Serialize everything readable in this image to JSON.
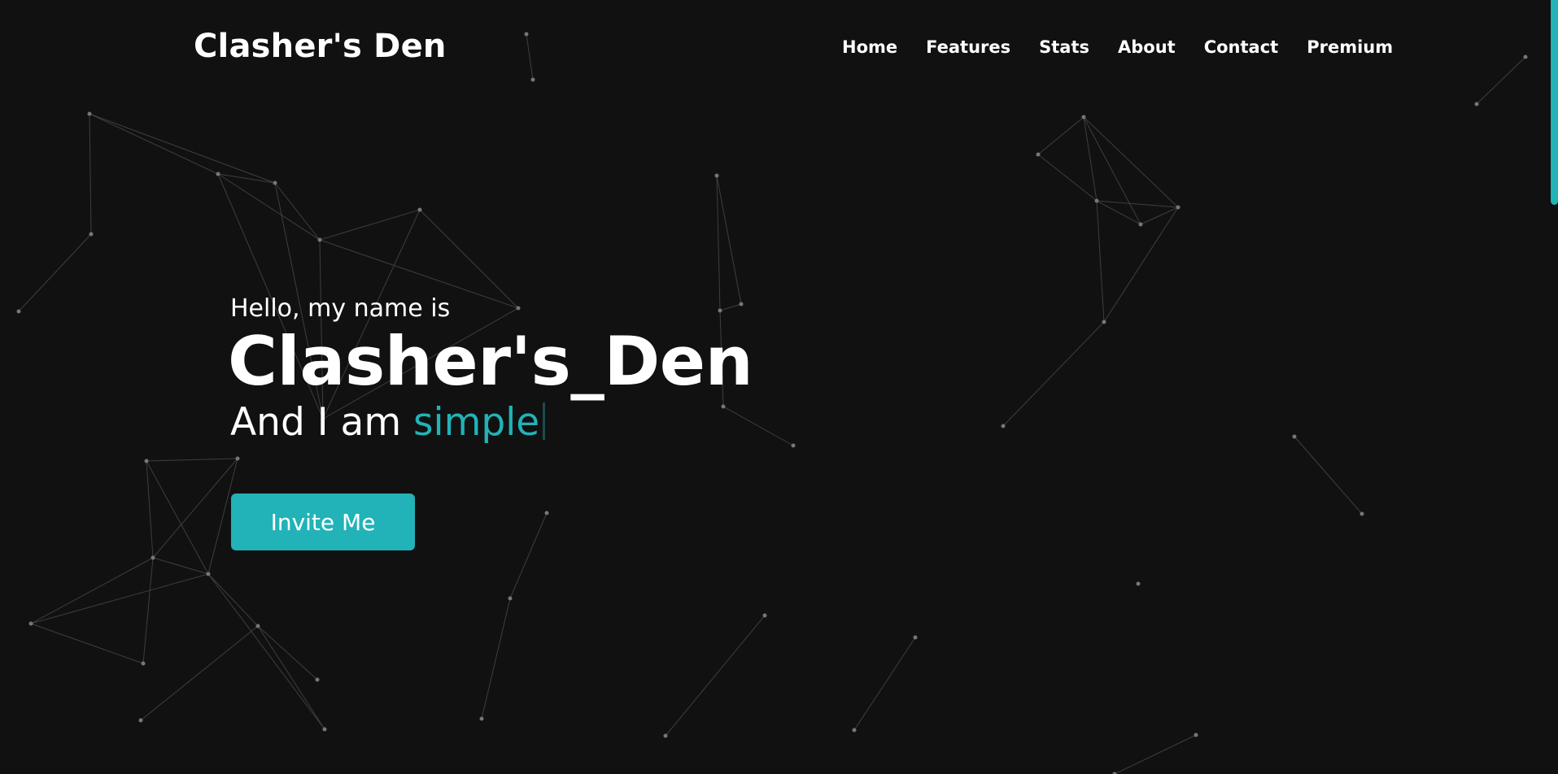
{
  "brand": {
    "title": "Clasher's Den"
  },
  "nav": {
    "items": [
      {
        "label": "Home"
      },
      {
        "label": "Features"
      },
      {
        "label": "Stats"
      },
      {
        "label": "About"
      },
      {
        "label": "Contact"
      },
      {
        "label": "Premium"
      }
    ]
  },
  "hero": {
    "greeting": "Hello, my name is",
    "name": "Clasher's_Den",
    "tagline_prefix": "And I am ",
    "typed_word": "simple",
    "button_label": "Invite Me"
  },
  "colors": {
    "background": "#111111",
    "accent": "#21b3b7",
    "text": "#ffffff",
    "particle_line": "#4a4a4a",
    "particle_dot": "#777777"
  }
}
